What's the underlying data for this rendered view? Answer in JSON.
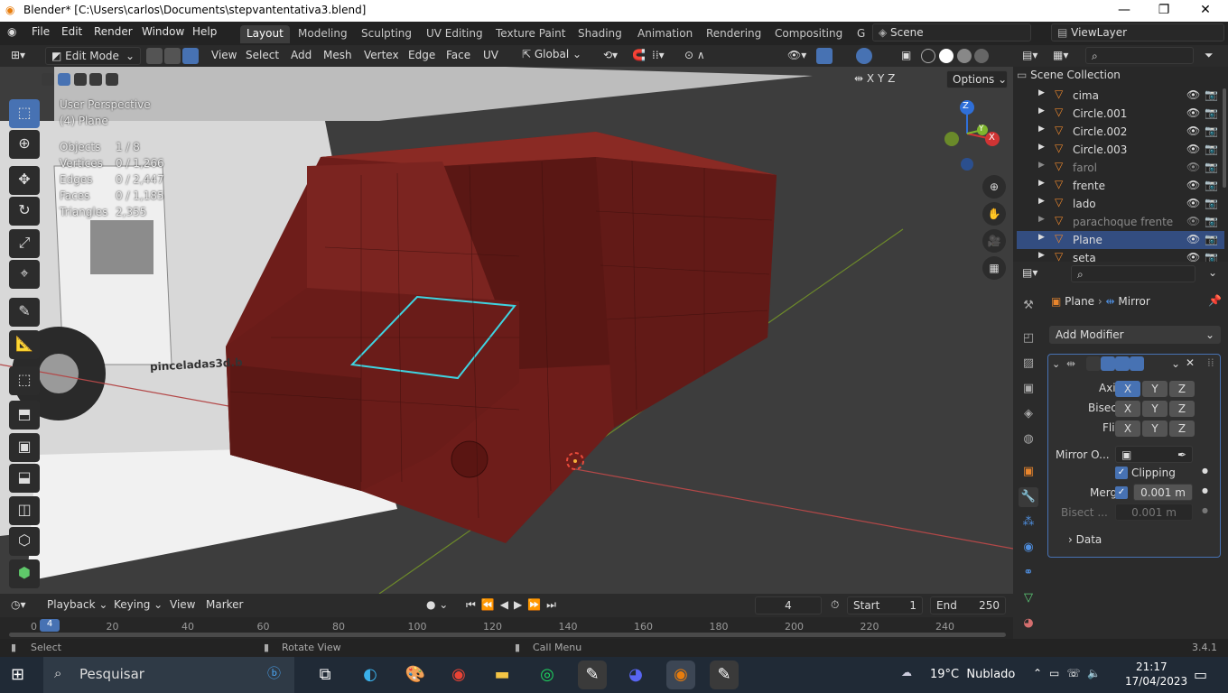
{
  "window": {
    "title": "Blender* [C:\\Users\\carlos\\Documents\\stepvantentativa3.blend]",
    "minimize": "—",
    "maximize": "❐",
    "close": "✕"
  },
  "menu": {
    "items": [
      "File",
      "Edit",
      "Render",
      "Window",
      "Help"
    ],
    "workspaces": [
      "Layout",
      "Modeling",
      "Sculpting",
      "UV Editing",
      "Texture Paint",
      "Shading",
      "Animation",
      "Rendering",
      "Compositing",
      "G"
    ],
    "scene": "Scene",
    "view_layer": "ViewLayer"
  },
  "viewport_header": {
    "mode": "Edit Mode",
    "menus": [
      "View",
      "Select",
      "Add",
      "Mesh",
      "Vertex",
      "Edge",
      "Face",
      "UV"
    ],
    "orientation": "Global",
    "options": "Options",
    "axes": [
      "X",
      "Y",
      "Z"
    ]
  },
  "overlay": {
    "view_name": "User Perspective",
    "object_name": "(4) Plane",
    "stats": [
      {
        "label": "Objects",
        "value": "1 / 8"
      },
      {
        "label": "Vertices",
        "value": "0 / 1,266"
      },
      {
        "label": "Edges",
        "value": "0 / 2,447"
      },
      {
        "label": "Faces",
        "value": "0 / 1,185"
      },
      {
        "label": "Triangles",
        "value": "2,355"
      }
    ],
    "watermark": "pinceladas3d.b",
    "gizmo": {
      "x": "X",
      "y": "Y",
      "z": "Z"
    }
  },
  "timeline": {
    "menus": [
      "Playback",
      "Keying",
      "View",
      "Marker"
    ],
    "current_frame": "4",
    "start_label": "Start",
    "start": "1",
    "end_label": "End",
    "end": "250",
    "ticks": [
      "0",
      "20",
      "40",
      "60",
      "80",
      "100",
      "120",
      "140",
      "160",
      "180",
      "200",
      "220",
      "240"
    ],
    "playhead": "4"
  },
  "statusbar": {
    "select": "Select",
    "rotate": "Rotate View",
    "menu": "Call Menu",
    "version": "3.4.1"
  },
  "outliner": {
    "collection": "Scene Collection",
    "items": [
      {
        "name": "cima",
        "state": "normal"
      },
      {
        "name": "Circle.001",
        "state": "normal"
      },
      {
        "name": "Circle.002",
        "state": "normal"
      },
      {
        "name": "Circle.003",
        "state": "normal"
      },
      {
        "name": "farol",
        "state": "dim"
      },
      {
        "name": "frente",
        "state": "normal"
      },
      {
        "name": "lado",
        "state": "normal"
      },
      {
        "name": "parachoque frente",
        "state": "dim"
      },
      {
        "name": "Plane",
        "state": "selected"
      },
      {
        "name": "seta",
        "state": "normal"
      }
    ]
  },
  "properties": {
    "breadcrumb_object": "Plane",
    "breadcrumb_modifier": "Mirror",
    "add_modifier": "Add Modifier",
    "axis_label": "Axis",
    "bisect_label": "Bisect",
    "flip_label": "Flip",
    "mirror_object_label": "Mirror O...",
    "clipping_label": "Clipping",
    "merge_label": "Merge",
    "merge_value": "0.001 m",
    "bisect_dist_label": "Bisect ...",
    "bisect_dist_value": "0.001 m",
    "data_label": "Data"
  },
  "taskbar": {
    "search": "Pesquisar",
    "weather": "19°C  Nublado",
    "time": "21:17",
    "date": "17/04/2023"
  },
  "colors": {
    "accent": "#4772b3",
    "mesh": "#6e1d1a",
    "selected_edge": "#3fd3e0"
  }
}
